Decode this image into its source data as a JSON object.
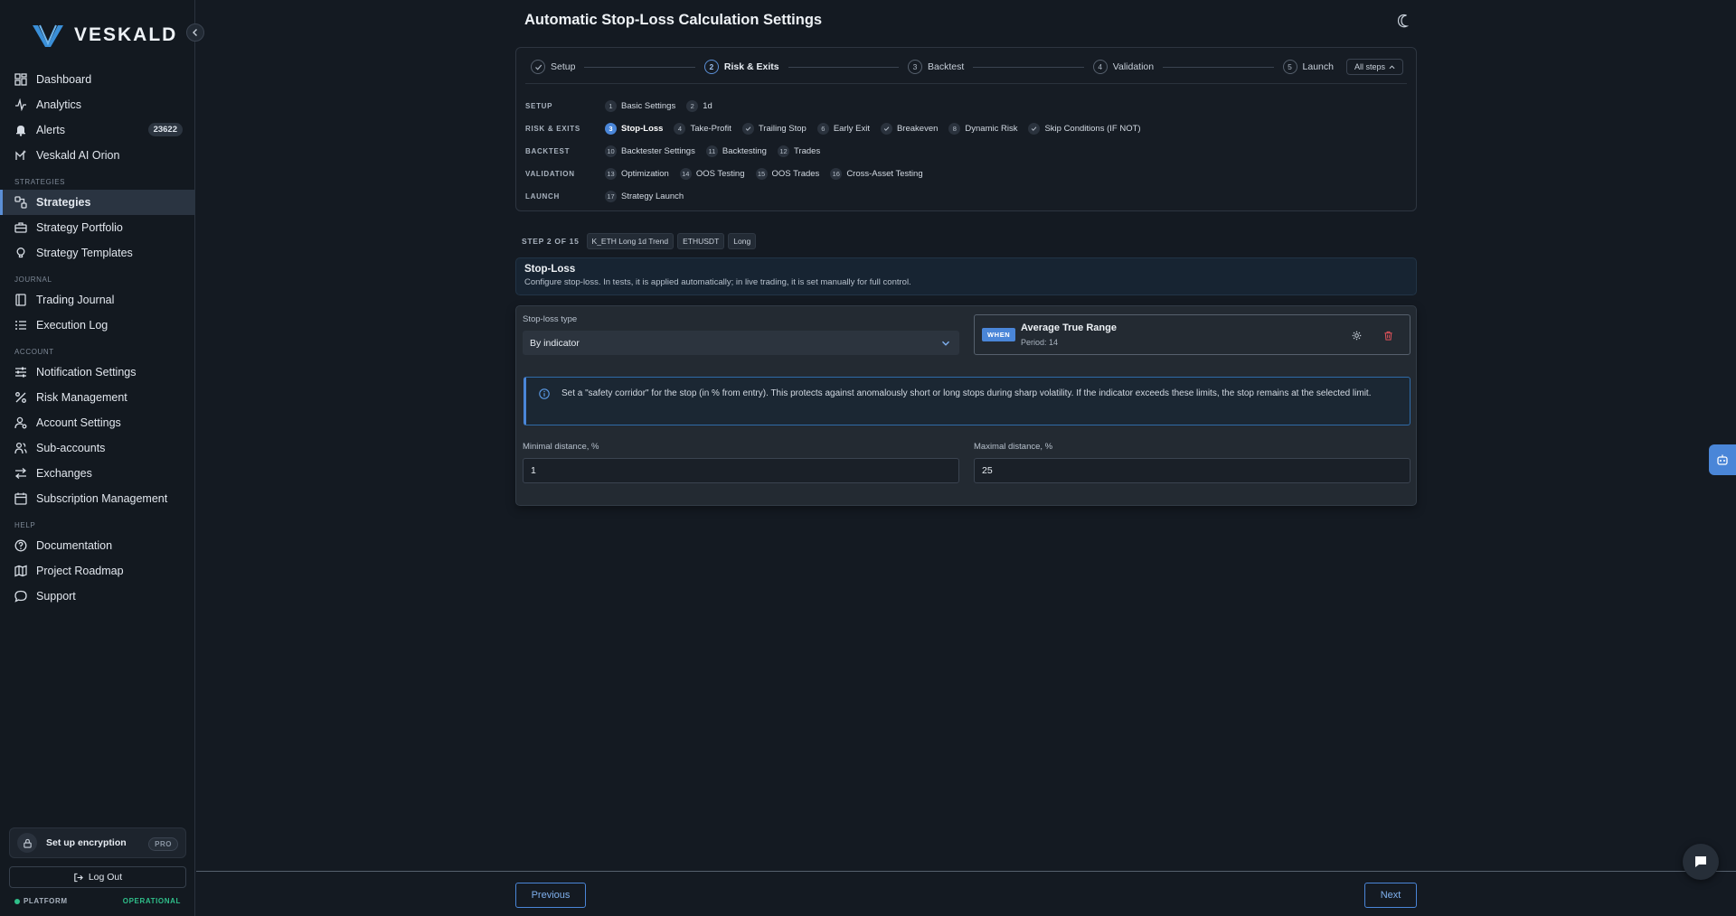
{
  "brand": {
    "name": "VESKALD",
    "accent": "#4a86d8"
  },
  "sidebar": {
    "main": [
      {
        "label": "Dashboard",
        "icon": "dashboard-icon"
      },
      {
        "label": "Analytics",
        "icon": "analytics-icon"
      },
      {
        "label": "Alerts",
        "icon": "bell-icon",
        "badge": "23622"
      },
      {
        "label": "Veskald AI Orion",
        "icon": "ai-icon"
      }
    ],
    "sections": {
      "strategies": "STRATEGIES",
      "journal": "JOURNAL",
      "account": "ACCOUNT",
      "help": "HELP"
    },
    "strategies": [
      {
        "label": "Strategies",
        "icon": "strategies-icon",
        "active": true
      },
      {
        "label": "Strategy Portfolio",
        "icon": "briefcase-icon"
      },
      {
        "label": "Strategy Templates",
        "icon": "bulb-icon"
      }
    ],
    "journal": [
      {
        "label": "Trading Journal",
        "icon": "book-icon"
      },
      {
        "label": "Execution Log",
        "icon": "list-icon"
      }
    ],
    "account": [
      {
        "label": "Notification Settings",
        "icon": "sliders-icon"
      },
      {
        "label": "Risk Management",
        "icon": "percent-icon"
      },
      {
        "label": "Account Settings",
        "icon": "user-gear-icon"
      },
      {
        "label": "Sub-accounts",
        "icon": "users-icon"
      },
      {
        "label": "Exchanges",
        "icon": "exchange-icon"
      },
      {
        "label": "Subscription Management",
        "icon": "calendar-icon"
      }
    ],
    "help": [
      {
        "label": "Documentation",
        "icon": "help-circle-icon"
      },
      {
        "label": "Project Roadmap",
        "icon": "map-icon"
      },
      {
        "label": "Support",
        "icon": "chat-icon"
      }
    ],
    "encryption": {
      "label": "Set up encryption",
      "badge": "PRO"
    },
    "logout": "Log Out",
    "platform": {
      "label": "PLATFORM",
      "status": "OPERATIONAL",
      "status_color": "#2fbf8a"
    }
  },
  "page": {
    "title": "Automatic Stop-Loss Calculation Settings"
  },
  "stepper": {
    "steps": [
      {
        "num": "1",
        "label": "Setup",
        "state": "done"
      },
      {
        "num": "2",
        "label": "Risk & Exits",
        "state": "current"
      },
      {
        "num": "3",
        "label": "Backtest",
        "state": "todo"
      },
      {
        "num": "4",
        "label": "Validation",
        "state": "todo"
      },
      {
        "num": "5",
        "label": "Launch",
        "state": "todo"
      }
    ],
    "all_steps": "All steps",
    "groups": [
      {
        "label": "SETUP",
        "items": [
          {
            "num": "1",
            "label": "Basic Settings"
          },
          {
            "num": "2",
            "label": "1d"
          }
        ]
      },
      {
        "label": "RISK & EXITS",
        "items": [
          {
            "num": "3",
            "label": "Stop-Loss",
            "current": true
          },
          {
            "num": "4",
            "label": "Take-Profit"
          },
          {
            "num": "",
            "label": "Trailing Stop",
            "check": true
          },
          {
            "num": "6",
            "label": "Early Exit"
          },
          {
            "num": "",
            "label": "Breakeven",
            "check": true
          },
          {
            "num": "8",
            "label": "Dynamic Risk"
          },
          {
            "num": "",
            "label": "Skip Conditions (IF NOT)",
            "check": true
          }
        ]
      },
      {
        "label": "BACKTEST",
        "items": [
          {
            "num": "10",
            "label": "Backtester Settings"
          },
          {
            "num": "11",
            "label": "Backtesting"
          },
          {
            "num": "12",
            "label": "Trades"
          }
        ]
      },
      {
        "label": "VALIDATION",
        "items": [
          {
            "num": "13",
            "label": "Optimization"
          },
          {
            "num": "14",
            "label": "OOS Testing"
          },
          {
            "num": "15",
            "label": "OOS Trades"
          },
          {
            "num": "16",
            "label": "Cross-Asset Testing"
          }
        ]
      },
      {
        "label": "LAUNCH",
        "items": [
          {
            "num": "17",
            "label": "Strategy Launch"
          }
        ]
      }
    ]
  },
  "step_meta": {
    "step_of": "STEP 2 OF 15",
    "tags": [
      "K_ETH Long 1d Trend",
      "ETHUSDT",
      "Long"
    ]
  },
  "section": {
    "title": "Stop-Loss",
    "description": "Configure stop-loss. In tests, it is applied automatically; in live trading, it is set manually for full control."
  },
  "form": {
    "type_label": "Stop-loss type",
    "type_value": "By indicator",
    "indicator": {
      "when": "WHEN",
      "name": "Average True Range",
      "period": "Period: 14"
    },
    "alert": "Set a \"safety corridor\" for the stop (in % from entry). This protects against anomalously short or long stops during sharp volatility. If the indicator exceeds these limits, the stop remains at the selected limit.",
    "min_label": "Minimal distance, %",
    "min_value": "1",
    "max_label": "Maximal distance, %",
    "max_value": "25"
  },
  "footer": {
    "previous": "Previous",
    "next": "Next"
  }
}
